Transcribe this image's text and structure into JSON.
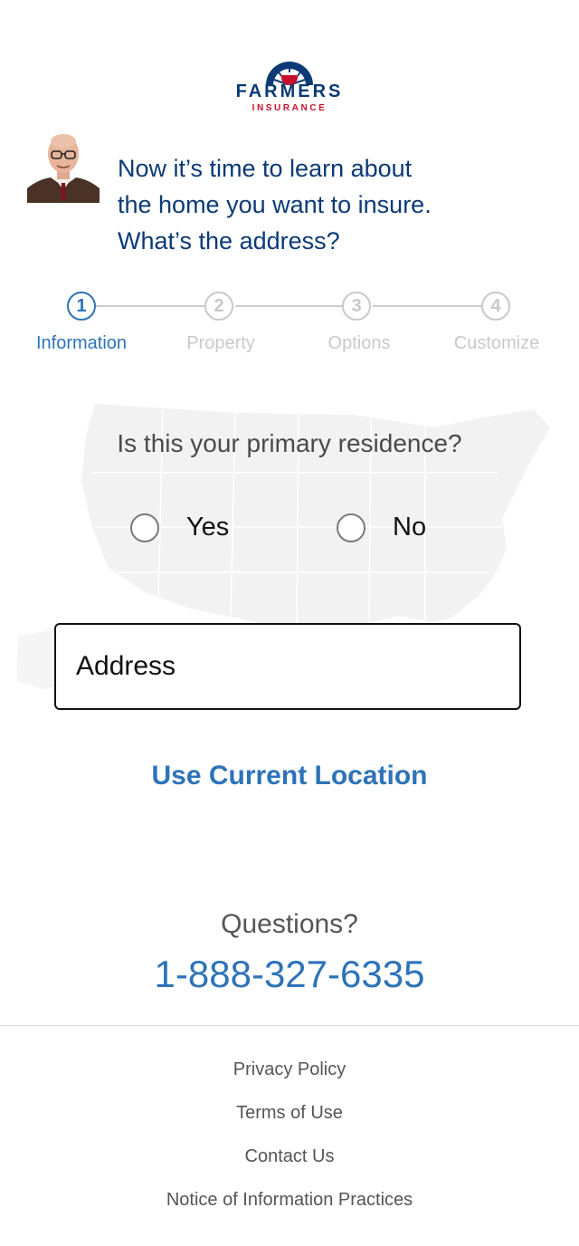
{
  "brand": {
    "name": "FARMERS",
    "sub": "INSURANCE"
  },
  "intro": {
    "line1": "Now it’s time to learn about",
    "line2": "the home you want to insure.",
    "line3": "What’s the address?"
  },
  "steps": [
    {
      "num": "1",
      "label": "Information",
      "active": true
    },
    {
      "num": "2",
      "label": "Property",
      "active": false
    },
    {
      "num": "3",
      "label": "Options",
      "active": false
    },
    {
      "num": "4",
      "label": "Customize",
      "active": false
    }
  ],
  "question": "Is this your primary residence?",
  "options": {
    "yes": "Yes",
    "no": "No"
  },
  "address": {
    "placeholder": "Address",
    "value": ""
  },
  "use_location": "Use Current Location",
  "questions_label": "Questions?",
  "phone": "1-888-327-6335",
  "footer": {
    "privacy": "Privacy Policy",
    "terms": "Terms of Use",
    "contact": "Contact Us",
    "notice": "Notice of Information Practices"
  },
  "colors": {
    "navy": "#0b3a75",
    "accent": "#2e73b8",
    "brand_red": "#c8102e"
  }
}
